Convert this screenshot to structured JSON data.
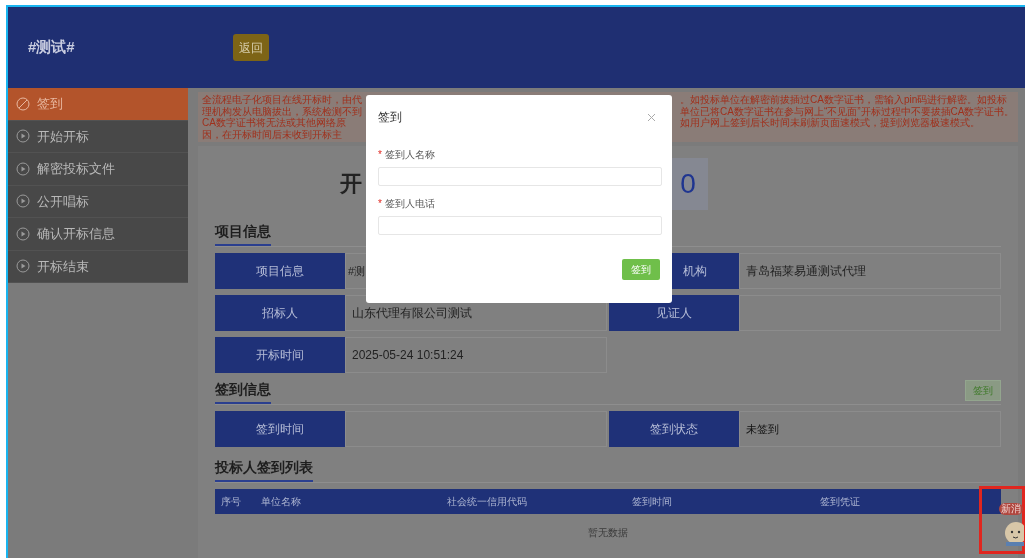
{
  "header": {
    "title": "#测试#",
    "back_button": "返回"
  },
  "sidebar": {
    "items": [
      {
        "label": "签到",
        "selected": true
      },
      {
        "label": "开始开标",
        "selected": false
      },
      {
        "label": "解密投标文件",
        "selected": false
      },
      {
        "label": "公开唱标",
        "selected": false
      },
      {
        "label": "确认开标信息",
        "selected": false
      },
      {
        "label": "开标结束",
        "selected": false
      }
    ]
  },
  "notice": {
    "left_lines": [
      "全流程电子化项目在线开标时，由代理机构发",
      "从电脑拔出，系统检测不到CA数字证书将无法",
      "或其他网络原因，在开标时间后未收到开标主"
    ],
    "right_lines": [
      "。如投标单位在解密前拔插过CA数字证书，需输入pin码进行解密。如投标单位已将CA数字证书",
      "在参与网上“不见面”开标过程中不要拔插CA数字证书。如用户网上签到后长时间未刷新页面",
      "速模式，提到浏览器极速模式。"
    ]
  },
  "countdown": {
    "title_visible": "开",
    "value": "0"
  },
  "project_info": {
    "title": "项目信息",
    "rows": [
      [
        {
          "label": "项目信息",
          "value": "#测",
          "label_clipped": false
        },
        {
          "label": "机构",
          "value": "青岛福莱易通测试代理",
          "label_clipped": true
        }
      ],
      [
        {
          "label": "招标人",
          "value": "山东代理有限公司测试",
          "label_clipped": false
        },
        {
          "label": "见证人",
          "label_clipped": false
        }
      ],
      [
        {
          "label": "开标时间",
          "value": "2025-05-24 10:51:24",
          "label_clipped": false
        }
      ]
    ]
  },
  "signin_info": {
    "title": "签到信息",
    "button": "签到",
    "rows": [
      [
        {
          "label": "签到时间",
          "label_clipped": false
        },
        {
          "label": "签到状态",
          "value": "未签到",
          "label_clipped": false
        }
      ]
    ]
  },
  "bidder_list": {
    "title": "投标人签到列表",
    "columns": [
      "序号",
      "单位名称",
      "社会统一信用代码",
      "签到时间",
      "签到凭证"
    ],
    "empty_text": "暂无数据"
  },
  "chat_widget": {
    "badge": "新消"
  },
  "dialog": {
    "title": "签到",
    "fields": [
      {
        "label": "签到人名称",
        "required_mark": "*"
      },
      {
        "label": "签到人电话",
        "required_mark": "*"
      }
    ],
    "submit": "签到"
  }
}
